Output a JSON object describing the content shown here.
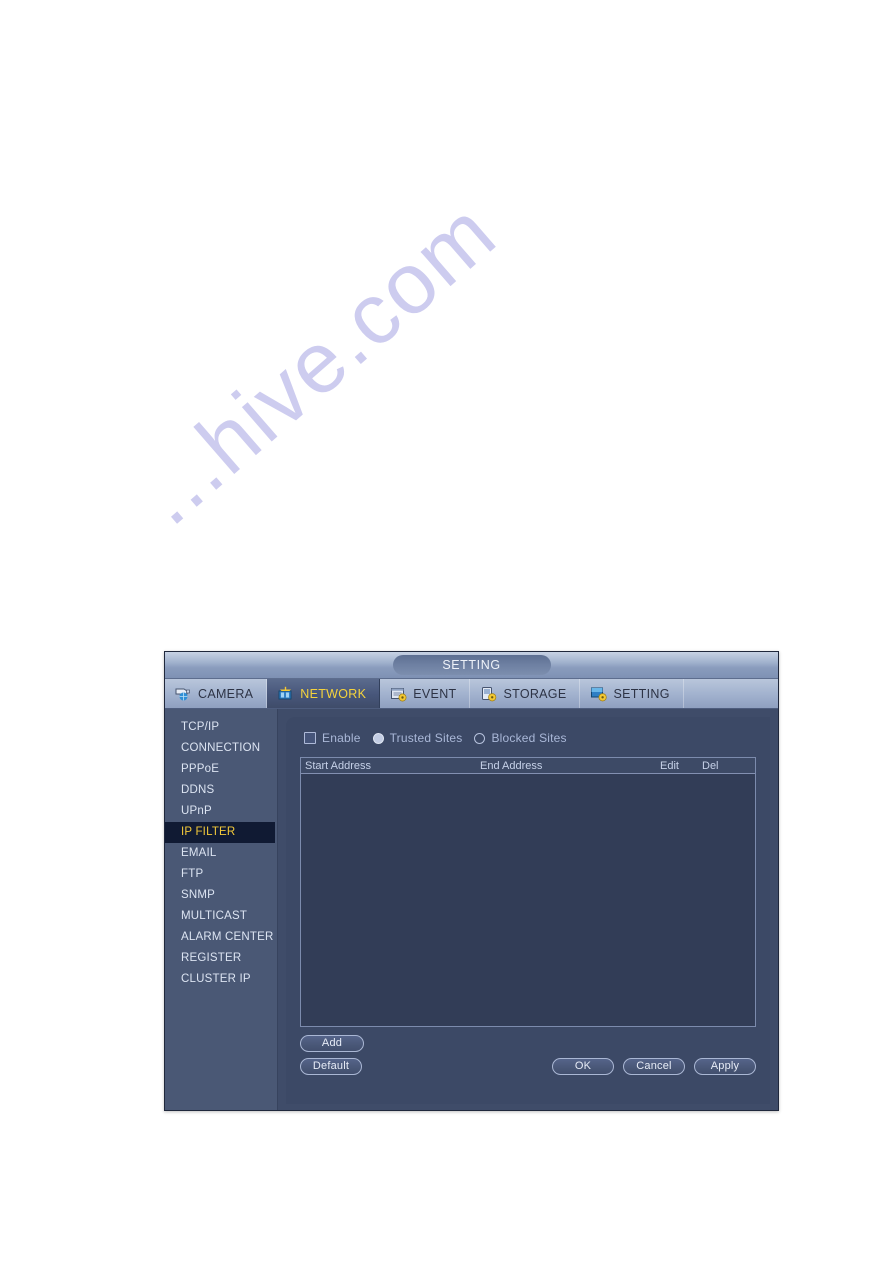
{
  "page": {
    "watermark": "...hive.com"
  },
  "window": {
    "title": "SETTING",
    "tabs": [
      {
        "label": "CAMERA",
        "icon": "camera-icon",
        "active": false
      },
      {
        "label": "NETWORK",
        "icon": "network-icon",
        "active": true
      },
      {
        "label": "EVENT",
        "icon": "event-icon",
        "active": false
      },
      {
        "label": "STORAGE",
        "icon": "storage-icon",
        "active": false
      },
      {
        "label": "SETTING",
        "icon": "setting-icon",
        "active": false
      }
    ]
  },
  "sidebar": {
    "selected": "IP FILTER",
    "items": [
      {
        "label": "TCP/IP",
        "selected": false
      },
      {
        "label": "CONNECTION",
        "selected": false
      },
      {
        "label": "PPPoE",
        "selected": false
      },
      {
        "label": "DDNS",
        "selected": false
      },
      {
        "label": "UPnP",
        "selected": false
      },
      {
        "label": "IP FILTER",
        "selected": true
      },
      {
        "label": "EMAIL",
        "selected": false
      },
      {
        "label": "FTP",
        "selected": false
      },
      {
        "label": "SNMP",
        "selected": false
      },
      {
        "label": "MULTICAST",
        "selected": false
      },
      {
        "label": "ALARM CENTER",
        "selected": false
      },
      {
        "label": "REGISTER",
        "selected": false
      },
      {
        "label": "CLUSTER IP",
        "selected": false
      }
    ]
  },
  "panel": {
    "enable_label": "Enable",
    "enable_checked": false,
    "trusted_sites_label": "Trusted Sites",
    "blocked_sites_label": "Blocked Sites",
    "site_mode_selected": "Trusted Sites",
    "table": {
      "columns": [
        "Start Address",
        "End Address",
        "Edit",
        "Del"
      ],
      "rows": []
    },
    "buttons": {
      "add": "Add",
      "default": "Default",
      "ok": "OK",
      "cancel": "Cancel",
      "apply": "Apply"
    }
  },
  "colors": {
    "window_body": "#3f4c69",
    "sidebar": "#4a5875",
    "panel": "#3c4966",
    "table_body": "#323d57",
    "titlebar_light": "#b9c6db",
    "selected_item_bg": "#101a33",
    "selected_item_text": "#f3c93a",
    "active_tab_text": "#f5d33c",
    "label_text": "#aab8d8",
    "watermark": "#c9c8ee"
  }
}
